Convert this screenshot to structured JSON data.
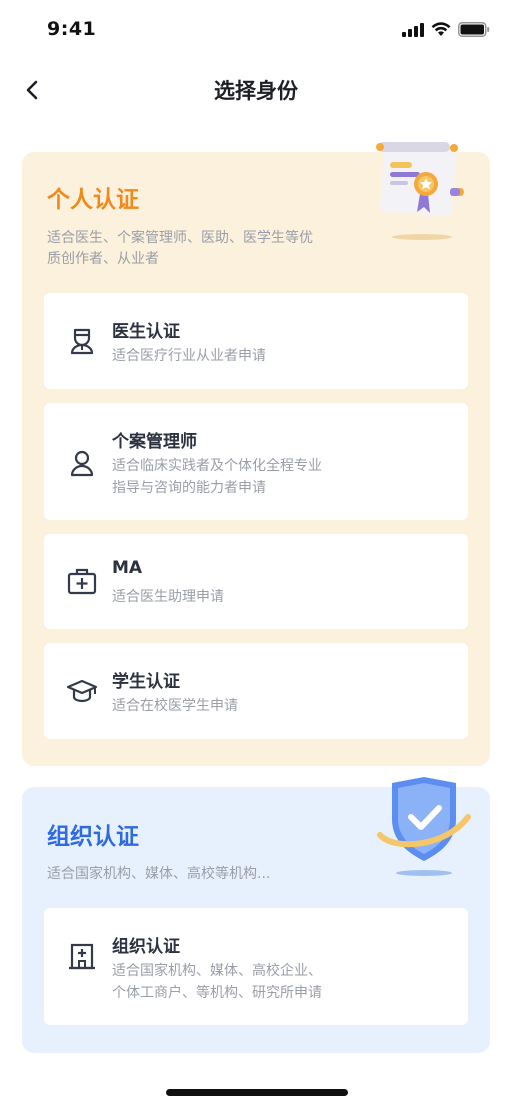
{
  "status_bar": {
    "time": "9:41"
  },
  "nav": {
    "title": "选择身份"
  },
  "personal": {
    "title": "个人认证",
    "desc_line1": "适合医生、个案管理师、医助、医学生等优",
    "desc_line2": "质创作者、从业者",
    "accent_color": "#f2891b",
    "items": [
      {
        "title": "医生认证",
        "desc_line1": "适合医疗行业从业者申请",
        "icon": "doctor-icon"
      },
      {
        "title": "个案管理师",
        "desc_line1": "适合临床实践者及个体化全程专业",
        "desc_line2": "指导与咨询的能力者申请",
        "icon": "person-icon"
      },
      {
        "title": "MA",
        "desc_line1": "适合医生助理申请",
        "icon": "medical-kit-icon"
      },
      {
        "title": "学生认证",
        "desc_line1": "适合在校医学生申请",
        "icon": "graduation-cap-icon"
      }
    ]
  },
  "organization": {
    "title": "组织认证",
    "desc_line1": "适合国家机构、媒体、高校等机构...",
    "accent_color": "#2f6ae0",
    "items": [
      {
        "title": "组织认证",
        "desc_line1": "适合国家机构、媒体、高校企业、",
        "desc_line2": "个体工商户、等机构、研究所申请",
        "icon": "hospital-building-icon"
      }
    ]
  }
}
